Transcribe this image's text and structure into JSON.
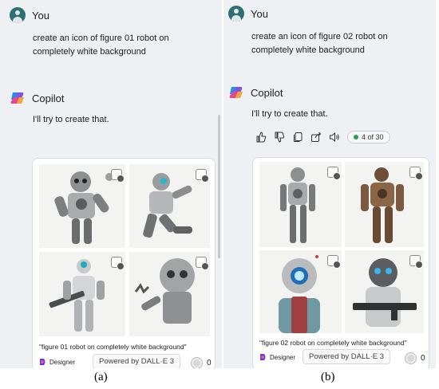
{
  "panels": {
    "a": {
      "user_name": "You",
      "prompt": "create an icon of figure 01 robot on completely white background",
      "assistant_name": "Copilot",
      "reply": "I'll try to create that.",
      "caption": "\"figure 01 robot on completely white background\"",
      "designer_label": "Designer",
      "powered_by": "Powered by DALL·E 3",
      "like_count": "0",
      "label": "(a)"
    },
    "b": {
      "user_name": "You",
      "prompt": "create an icon of figure 02 robot on completely white background",
      "assistant_name": "Copilot",
      "reply": "I'll try to create that.",
      "response_counter": "4 of 30",
      "caption": "\"figure 02 robot on completely white background\"",
      "designer_label": "Designer",
      "powered_by": "Powered by DALL·E 3",
      "like_count": "0",
      "label": "(b)"
    }
  },
  "toolbar_icons": [
    "thumbs-up-icon",
    "thumbs-down-icon",
    "copy-icon",
    "share-icon",
    "read-aloud-icon"
  ],
  "colors": {
    "panel_bg": "#eef0f4",
    "user_avatar": "#2f6f73",
    "counter_dot": "#2e9e4a"
  }
}
